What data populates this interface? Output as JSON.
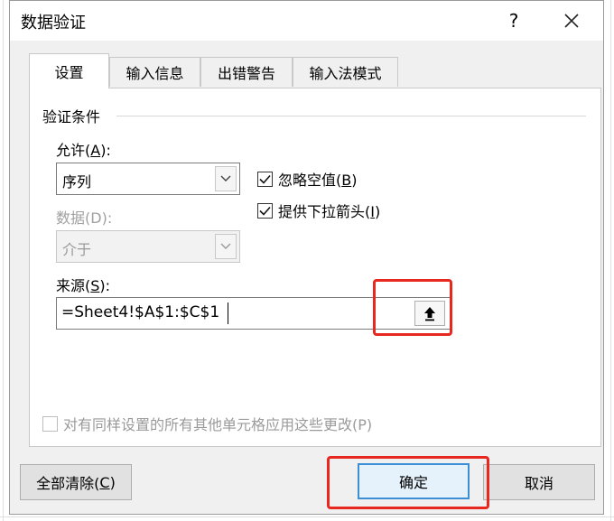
{
  "dialog": {
    "title": "数据验证",
    "help_label": "?",
    "close_icon": "close-icon"
  },
  "tabs": [
    {
      "label": "设置",
      "active": true
    },
    {
      "label": "输入信息",
      "active": false
    },
    {
      "label": "出错警告",
      "active": false
    },
    {
      "label": "输入法模式",
      "active": false
    }
  ],
  "settings": {
    "group_label": "验证条件",
    "allow": {
      "label_prefix": "允许(",
      "label_key": "A",
      "label_suffix": "):",
      "value": "序列"
    },
    "data": {
      "label_prefix": "数据(",
      "label_key": "D",
      "label_suffix": "):",
      "value": "介于",
      "disabled": true
    },
    "ignore_blank": {
      "label_prefix": "忽略空值(",
      "label_key": "B",
      "label_suffix": ")",
      "checked": true
    },
    "in_cell_dropdown": {
      "label_prefix": "提供下拉箭头(",
      "label_key": "I",
      "label_suffix": ")",
      "checked": true
    },
    "source": {
      "label_prefix": "来源(",
      "label_key": "S",
      "label_suffix": "):",
      "value": "=Sheet4!$A$1:$C$1",
      "collapse_icon": "collapse-dialog-arrow-up-icon"
    },
    "apply_all": {
      "label": "对有同样设置的所有其他单元格应用这些更改(P)",
      "checked": false,
      "disabled": true
    }
  },
  "buttons": {
    "clear_all_prefix": "全部清除(",
    "clear_all_key": "C",
    "clear_all_suffix": ")",
    "ok": "确定",
    "cancel": "取消"
  },
  "colors": {
    "highlight": "#e8281f",
    "primary_border": "#3c8fd4"
  }
}
